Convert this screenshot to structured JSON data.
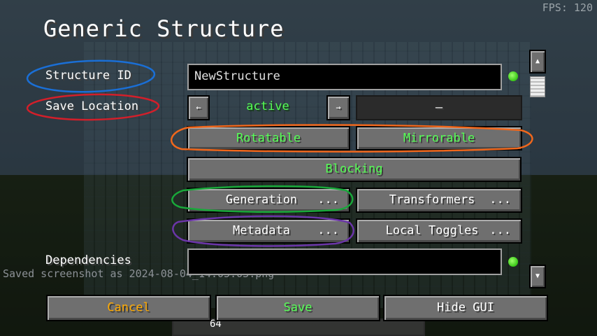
{
  "hud": {
    "fps": "FPS: 120",
    "chat_message": "Saved screenshot as 2024-08-04_14.05.03.png",
    "hotbar_count": "64"
  },
  "screen": {
    "title": "Generic Structure"
  },
  "structure_id": {
    "label": "Structure ID",
    "value": "NewStructure"
  },
  "save_location": {
    "label": "Save Location",
    "left_arrow": "←",
    "right_arrow": "→",
    "value": "active",
    "extra": "–"
  },
  "toggles": {
    "rotatable": "Rotatable",
    "mirrorable": "Mirrorable",
    "blocking": "Blocking"
  },
  "buttons": {
    "generation": "Generation",
    "transformers": "Transformers",
    "metadata": "Metadata",
    "local_toggles": "Local Toggles",
    "more": "..."
  },
  "dependencies": {
    "label": "Dependencies",
    "value": ""
  },
  "scroll": {
    "up": "▲",
    "down": "▼"
  },
  "footer": {
    "cancel": "Cancel",
    "save": "Save",
    "hide_gui": "Hide GUI"
  },
  "colors": {
    "enabled_text": "#55ff55",
    "cancel_text": "#ffaa00",
    "status_led": "#37c616",
    "annot_blue": "#1a6fd6",
    "annot_red": "#d31f2a",
    "annot_orange": "#f0671c",
    "annot_green": "#19a83a",
    "annot_purple": "#6b35a8"
  }
}
